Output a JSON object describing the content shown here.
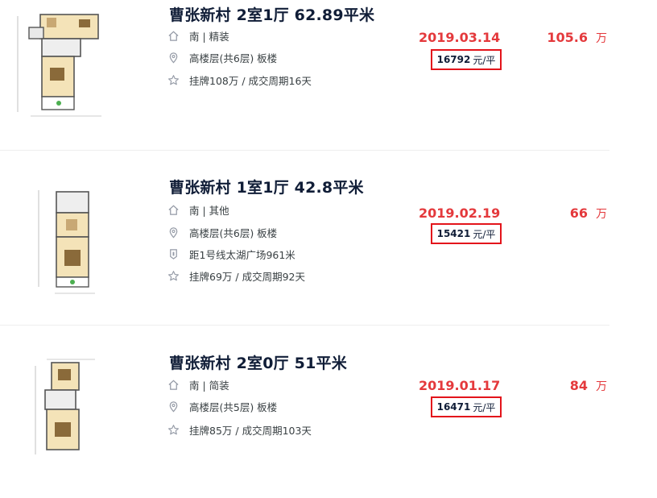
{
  "listings": [
    {
      "title": "曹张新村 2室1厅 62.89平米",
      "orientation_decoration": "南 | 精装",
      "floor_building": "高楼层(共6层) 板楼",
      "subway": "",
      "listing_info": "挂牌108万 / 成交周期16天",
      "deal_date": "2019.03.14",
      "total_price": "105.6",
      "price_unit": "万",
      "unit_price_value": "16792",
      "unit_price_unit": "元/平"
    },
    {
      "title": "曹张新村 1室1厅 42.8平米",
      "orientation_decoration": "南 | 其他",
      "floor_building": "高楼层(共6层) 板楼",
      "subway": "距1号线太湖广场961米",
      "listing_info": "挂牌69万 / 成交周期92天",
      "deal_date": "2019.02.19",
      "total_price": "66",
      "price_unit": "万",
      "unit_price_value": "15421",
      "unit_price_unit": "元/平"
    },
    {
      "title": "曹张新村 2室0厅 51平米",
      "orientation_decoration": "南 | 简装",
      "floor_building": "高楼层(共5层) 板楼",
      "subway": "",
      "listing_info": "挂牌85万 / 成交周期103天",
      "deal_date": "2019.01.17",
      "total_price": "84",
      "price_unit": "万",
      "unit_price_value": "16471",
      "unit_price_unit": "元/平"
    }
  ],
  "icons": {
    "house": "house-icon",
    "location": "location-pin-icon",
    "subway": "subway-icon",
    "star": "star-icon"
  },
  "colors": {
    "price_red": "#e4393c",
    "highlight_box": "#e3141b",
    "title": "#101d37",
    "text": "#394043"
  }
}
